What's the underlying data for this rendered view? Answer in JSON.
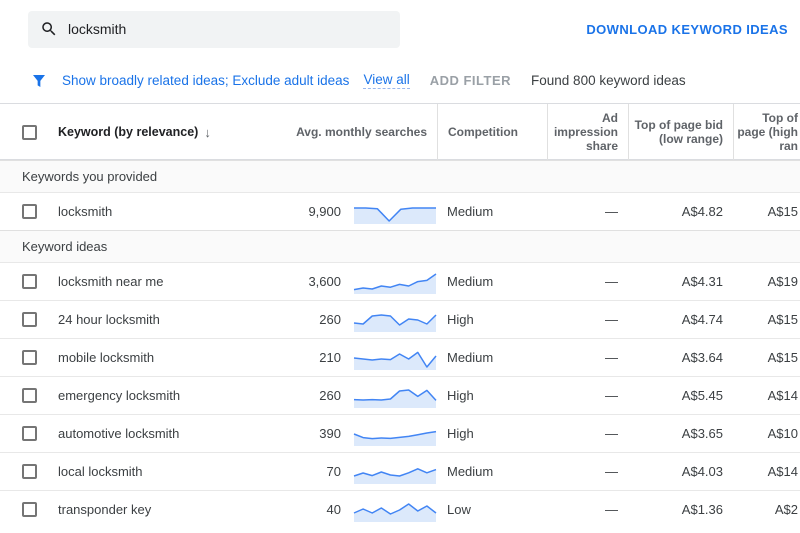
{
  "colors": {
    "accent": "#1a73e8",
    "spark_line": "#4285f4",
    "spark_fill": "#dce9fb"
  },
  "search": {
    "value": "locksmith"
  },
  "topbar": {
    "download_label": "DOWNLOAD KEYWORD IDEAS"
  },
  "filter_bar": {
    "active_filters": "Show broadly related ideas; Exclude adult ideas",
    "view_all": "View all",
    "add_filter": "ADD FILTER",
    "found": "Found 800 keyword ideas"
  },
  "table": {
    "columns": {
      "keyword": "Keyword (by relevance)",
      "sort_arrow": "↓",
      "searches": "Avg. monthly searches",
      "competition": "Competition",
      "ad_share": "Ad impression share",
      "bid_low": "Top of page bid (low range)",
      "bid_high": "Top of page (high ran"
    },
    "sections": [
      {
        "label": "Keywords you provided",
        "rows": [
          {
            "keyword": "locksmith",
            "searches": "9,900",
            "competition": "Medium",
            "ad_share": "—",
            "bid_low": "A$4.82",
            "bid_high": "A$15",
            "trend": [
              0.7,
              0.7,
              0.66,
              0.05,
              0.64,
              0.7,
              0.7,
              0.7
            ]
          }
        ]
      },
      {
        "label": "Keyword ideas",
        "rows": [
          {
            "keyword": "locksmith near me",
            "searches": "3,600",
            "competition": "Medium",
            "ad_share": "—",
            "bid_low": "A$4.31",
            "bid_high": "A$19",
            "trend": [
              0.12,
              0.2,
              0.15,
              0.3,
              0.24,
              0.38,
              0.3,
              0.52,
              0.58,
              0.9
            ]
          },
          {
            "keyword": "24 hour locksmith",
            "searches": "260",
            "competition": "High",
            "ad_share": "—",
            "bid_low": "A$4.74",
            "bid_high": "A$15",
            "trend": [
              0.35,
              0.3,
              0.7,
              0.75,
              0.7,
              0.25,
              0.55,
              0.5,
              0.3,
              0.75
            ]
          },
          {
            "keyword": "mobile locksmith",
            "searches": "210",
            "competition": "Medium",
            "ad_share": "—",
            "bid_low": "A$3.64",
            "bid_high": "A$15",
            "trend": [
              0.5,
              0.45,
              0.4,
              0.45,
              0.42,
              0.7,
              0.45,
              0.78,
              0.05,
              0.6
            ]
          },
          {
            "keyword": "emergency locksmith",
            "searches": "260",
            "competition": "High",
            "ad_share": "—",
            "bid_low": "A$5.45",
            "bid_high": "A$14",
            "trend": [
              0.32,
              0.3,
              0.32,
              0.3,
              0.35,
              0.75,
              0.8,
              0.48,
              0.78,
              0.28
            ]
          },
          {
            "keyword": "automotive locksmith",
            "searches": "390",
            "competition": "High",
            "ad_share": "—",
            "bid_low": "A$3.65",
            "bid_high": "A$10",
            "trend": [
              0.5,
              0.32,
              0.27,
              0.3,
              0.28,
              0.33,
              0.38,
              0.46,
              0.55,
              0.62
            ]
          },
          {
            "keyword": "local locksmith",
            "searches": "70",
            "competition": "Medium",
            "ad_share": "—",
            "bid_low": "A$4.03",
            "bid_high": "A$14",
            "trend": [
              0.3,
              0.45,
              0.32,
              0.5,
              0.35,
              0.3,
              0.46,
              0.66,
              0.46,
              0.62
            ]
          },
          {
            "keyword": "transponder key",
            "searches": "40",
            "competition": "Low",
            "ad_share": "—",
            "bid_low": "A$1.36",
            "bid_high": "A$2",
            "trend": [
              0.35,
              0.55,
              0.35,
              0.6,
              0.3,
              0.5,
              0.8,
              0.45,
              0.7,
              0.35
            ]
          }
        ]
      }
    ]
  }
}
